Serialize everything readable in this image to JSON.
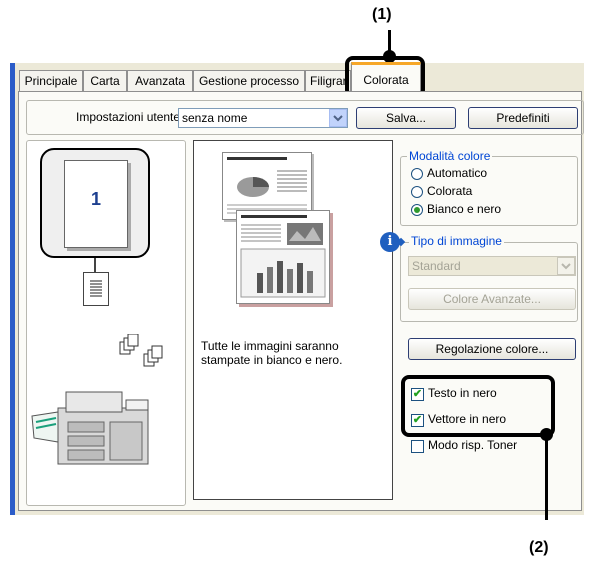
{
  "callouts": {
    "one": "(1)",
    "two": "(2)"
  },
  "tabs": [
    "Principale",
    "Carta",
    "Avanzata",
    "Gestione processo",
    "Filigrar",
    "Colorata"
  ],
  "user_settings": {
    "label": "Impostazioni utente:",
    "value": "senza nome",
    "save_label": "Salva...",
    "defaults_label": "Predefiniti"
  },
  "preview": {
    "page_number": "1",
    "description": "Tutte le immagini saranno stampate in bianco e nero."
  },
  "color_mode": {
    "legend": "Modalità colore",
    "options": [
      "Automatico",
      "Colorata",
      "Bianco e nero"
    ],
    "selected": "Bianco e nero"
  },
  "image_type": {
    "legend": "Tipo di immagine",
    "value": "Standard",
    "advanced_label": "Colore Avanzate..."
  },
  "color_adjust_label": "Regolazione colore...",
  "checkboxes": [
    {
      "label": "Testo in nero",
      "checked": true
    },
    {
      "label": "Vettore in nero",
      "checked": true
    },
    {
      "label": "Modo risp. Toner",
      "checked": false
    }
  ],
  "colors": {
    "accent_tab": "#f6a728",
    "selected_radio": "#2f9a2f",
    "info_icon": "#1f5fbf"
  }
}
